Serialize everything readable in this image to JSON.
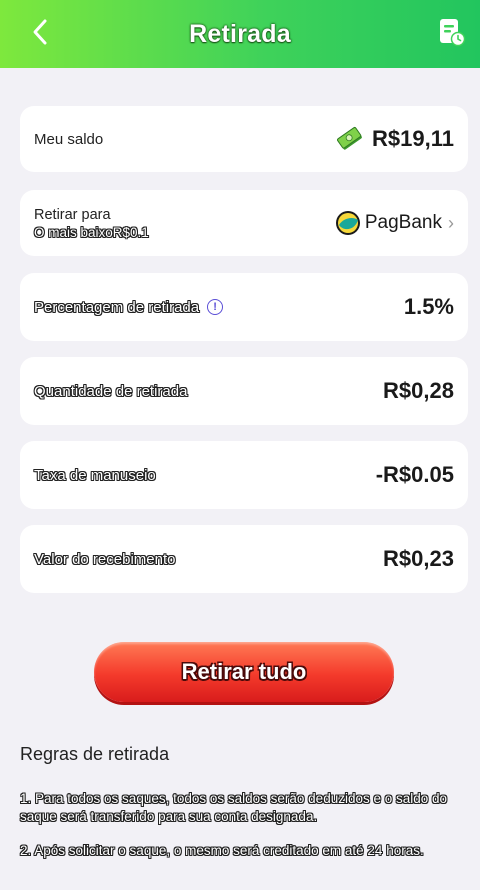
{
  "header": {
    "title": "Retirada"
  },
  "balance": {
    "label": "Meu saldo",
    "value": "R$19,11"
  },
  "withdraw_to": {
    "label": "Retirar para",
    "min_text": "O mais baixoR$0.1",
    "bank_name": "PagBank"
  },
  "percentage": {
    "label": "Percentagem de retirada",
    "value": "1.5%"
  },
  "quantity": {
    "label": "Quantidade de retirada",
    "value": "R$0,28"
  },
  "fee": {
    "label": "Taxa de manuseio",
    "value": "-R$0.05"
  },
  "receipt": {
    "label": "Valor do recebimento",
    "value": "R$0,23"
  },
  "actions": {
    "withdraw_all": "Retirar tudo"
  },
  "rules": {
    "title": "Regras de retirada",
    "items": [
      "1. Para todos os saques, todos os saldos serão deduzidos e o saldo do saque será transferido para sua conta designada.",
      "2. Após solicitar o saque, o mesmo será creditado em até 24 horas."
    ]
  },
  "colors": {
    "header_start": "#7ee83d",
    "header_end": "#22c55e",
    "button_top": "#ff7a55",
    "button_bottom": "#d91c1c",
    "info_accent": "#5b4fd6"
  },
  "icons": {
    "back": "chevron-left-icon",
    "records": "records-clock-icon",
    "money": "money-stack-icon",
    "bank": "pagbank-logo-icon",
    "info": "info-icon"
  }
}
